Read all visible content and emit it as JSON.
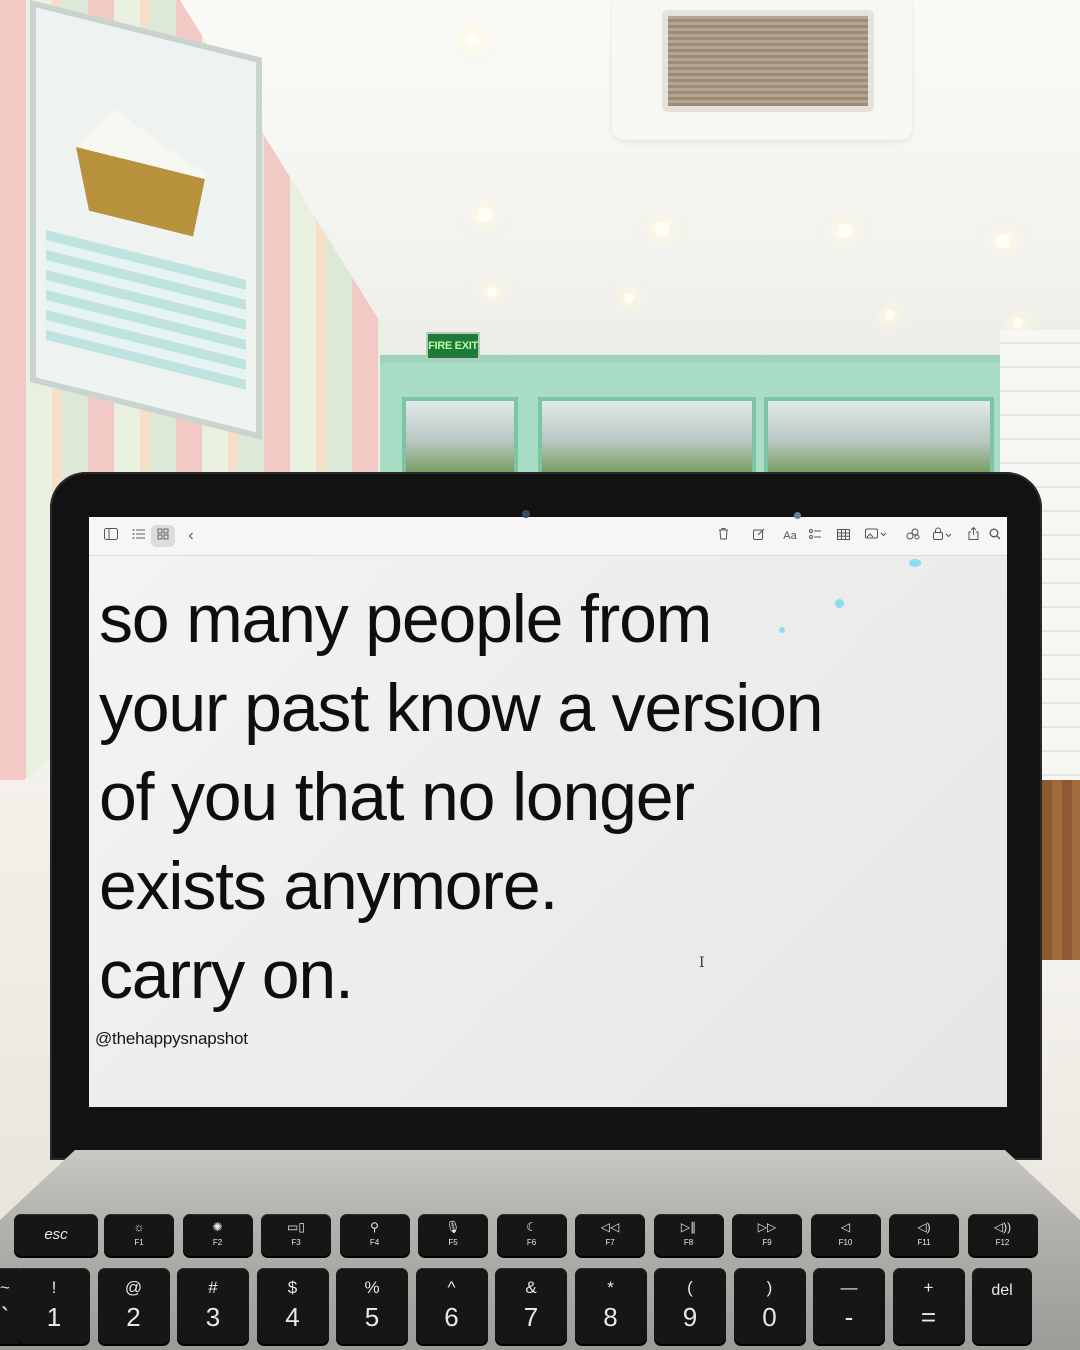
{
  "scene": {
    "exit_sign": "FIRE EXIT"
  },
  "toolbar": {
    "sidebar_toggle_icon": "sidebar-icon",
    "list_view_icon": "list-icon",
    "gallery_view_icon": "grid-icon",
    "back_icon": "chevron-left-icon",
    "delete_icon": "trash-icon",
    "compose_icon": "compose-icon",
    "format_label": "Aa",
    "checklist_icon": "checklist-icon",
    "table_icon": "table-icon",
    "media_icon": "media-icon",
    "collaborate_icon": "collaborate-icon",
    "lock_icon": "lock-icon",
    "share_icon": "share-icon",
    "search_icon": "search-icon"
  },
  "note": {
    "lines": [
      "so many people from",
      "your past know a version",
      "of you that no longer",
      "exists anymore.",
      "carry on."
    ],
    "handle": "@thehappysnapshot"
  },
  "keyboard": {
    "function_row": [
      {
        "label": "esc",
        "icon": ""
      },
      {
        "label": "F1",
        "icon": "brightness-down-icon"
      },
      {
        "label": "F2",
        "icon": "brightness-up-icon"
      },
      {
        "label": "F3",
        "icon": "mission-control-icon"
      },
      {
        "label": "F4",
        "icon": "search-icon"
      },
      {
        "label": "F5",
        "icon": "microphone-icon"
      },
      {
        "label": "F6",
        "icon": "moon-icon"
      },
      {
        "label": "F7",
        "icon": "rewind-icon"
      },
      {
        "label": "F8",
        "icon": "play-pause-icon"
      },
      {
        "label": "F9",
        "icon": "fast-forward-icon"
      },
      {
        "label": "F10",
        "icon": "mute-icon"
      },
      {
        "label": "F11",
        "icon": "volume-down-icon"
      },
      {
        "label": "F12",
        "icon": "volume-up-icon"
      }
    ],
    "number_row": [
      {
        "shift": "~",
        "main": "`"
      },
      {
        "shift": "!",
        "main": "1"
      },
      {
        "shift": "@",
        "main": "2"
      },
      {
        "shift": "#",
        "main": "3"
      },
      {
        "shift": "$",
        "main": "4"
      },
      {
        "shift": "%",
        "main": "5"
      },
      {
        "shift": "^",
        "main": "6"
      },
      {
        "shift": "&",
        "main": "7"
      },
      {
        "shift": "*",
        "main": "8"
      },
      {
        "shift": "(",
        "main": "9"
      },
      {
        "shift": ")",
        "main": "0"
      },
      {
        "shift": "—",
        "main": "-"
      },
      {
        "shift": "+",
        "main": "="
      },
      {
        "shift": "",
        "main": "del"
      }
    ]
  }
}
